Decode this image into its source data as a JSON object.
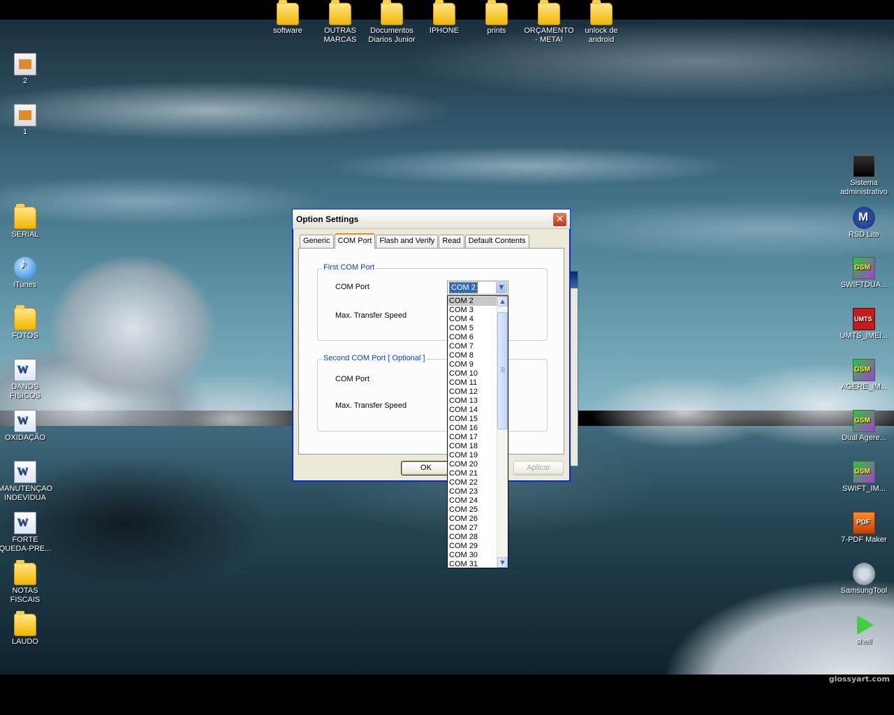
{
  "desktop": {
    "watermark": "glossyart.com",
    "top_icons": [
      {
        "label": "software",
        "icon": "network-folder-icon"
      },
      {
        "label": "OUTRAS MARCAS",
        "icon": "folder-icon"
      },
      {
        "label": "Documentos Diarios Junior",
        "icon": "network-folder-icon"
      },
      {
        "label": "IPHONE",
        "icon": "folder-icon"
      },
      {
        "label": "prints",
        "icon": "folder-icon"
      },
      {
        "label": "ORÇAMENTO - META!",
        "icon": "folder-icon"
      },
      {
        "label": "unlock de android",
        "icon": "folder-icon"
      }
    ],
    "left_icons": [
      {
        "label": "2",
        "icon": "file-icon"
      },
      {
        "label": "1",
        "icon": "file-icon"
      },
      {
        "label": "SERIAL",
        "icon": "folder-icon"
      },
      {
        "label": "iTunes",
        "icon": "itunes-icon"
      },
      {
        "label": "FOTOS",
        "icon": "folder-icon"
      },
      {
        "label": "DANOS FISICOS",
        "icon": "word-document-icon"
      },
      {
        "label": "OXIDAÇÃO",
        "icon": "word-document-icon"
      },
      {
        "label": "MANUTENÇAO INDEVIDUA",
        "icon": "word-document-icon"
      },
      {
        "label": "FORTE QUEDA-PRE...",
        "icon": "word-document-icon"
      },
      {
        "label": "NOTAS FISCAIS",
        "icon": "folder-icon"
      },
      {
        "label": "LAUDO",
        "icon": "folder-icon"
      }
    ],
    "right_icons": [
      {
        "label": "Sistema administrativo",
        "icon": "computer-icon"
      },
      {
        "label": "RSD Lite",
        "icon": "motorola-icon"
      },
      {
        "label": "SWIFTDUA...",
        "icon": "gsm-icon"
      },
      {
        "label": "UMTS_IMEI...",
        "icon": "umts-icon"
      },
      {
        "label": "AGERE_IM...",
        "icon": "gsm-icon"
      },
      {
        "label": "Dual Agere...",
        "icon": "gsm-icon"
      },
      {
        "label": "SWIFT_IM...",
        "icon": "gsm-icon"
      },
      {
        "label": "7-PDF Maker",
        "icon": "pdf-icon"
      },
      {
        "label": "SamsungTool",
        "icon": "gear-icon"
      },
      {
        "label": "shell",
        "icon": "shell-icon"
      }
    ]
  },
  "dialog": {
    "title": "Option Settings",
    "close_glyph": "✕",
    "tabs": [
      {
        "label": "Generic",
        "active": false
      },
      {
        "label": "COM Port",
        "active": true
      },
      {
        "label": "Flash and Verify",
        "active": false
      },
      {
        "label": "Read",
        "active": false
      },
      {
        "label": "Default Contents",
        "active": false
      }
    ],
    "first_group": {
      "legend": "First COM Port",
      "com_port_label": "COM Port",
      "speed_label": "Max. Transfer Speed",
      "com_port_value": "COM 2"
    },
    "second_group": {
      "legend": "Second COM Port [ Optional ]",
      "com_port_label": "COM Port",
      "speed_label": "Max. Transfer Speed"
    },
    "buttons": {
      "ok": "OK",
      "apply": "Aplicar"
    }
  },
  "dropdown": {
    "selected": "COM 2",
    "options": [
      "COM 2",
      "COM 3",
      "COM 4",
      "COM 5",
      "COM 6",
      "COM 7",
      "COM 8",
      "COM 9",
      "COM 10",
      "COM 11",
      "COM 12",
      "COM 13",
      "COM 14",
      "COM 15",
      "COM 16",
      "COM 17",
      "COM 18",
      "COM 19",
      "COM 20",
      "COM 21",
      "COM 22",
      "COM 23",
      "COM 24",
      "COM 25",
      "COM 26",
      "COM 27",
      "COM 28",
      "COM 29",
      "COM 30",
      "COM 31"
    ]
  },
  "colors": {
    "accent_tab": "#e68b2c",
    "legend_text": "#0046d5",
    "selection": "#316ac5"
  }
}
